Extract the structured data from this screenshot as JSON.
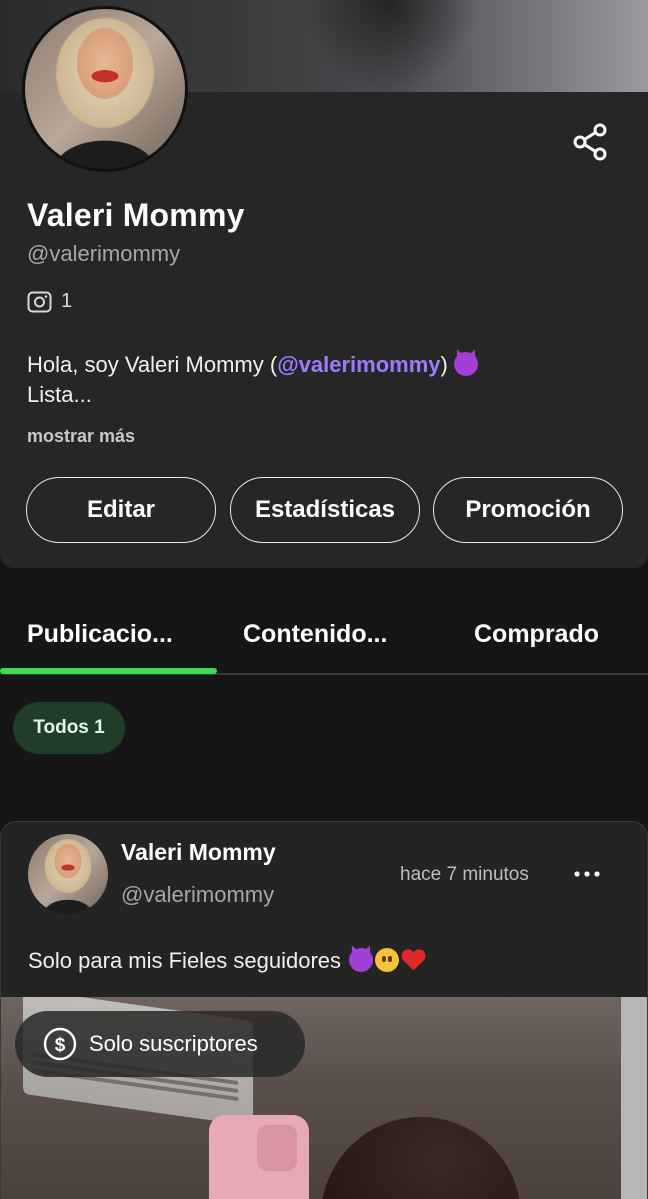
{
  "profile": {
    "display_name": "Valeri Mommy",
    "username": "@valerimommy",
    "post_count": "1",
    "bio_prefix": "Hola, soy Valeri Mommy (",
    "bio_mention": "@valerimommy",
    "bio_suffix": ")",
    "bio_line2": "Lista...",
    "show_more": "mostrar más"
  },
  "actions": {
    "edit": "Editar",
    "stats": "Estadísticas",
    "promo": "Promoción"
  },
  "tabs": [
    {
      "label": "Publicacio...",
      "active": true
    },
    {
      "label": "Contenido...",
      "active": false
    },
    {
      "label": "Comprado",
      "active": false
    }
  ],
  "filter": {
    "label": "Todos 1"
  },
  "post": {
    "author_name": "Valeri Mommy",
    "author_username": "@valerimommy",
    "time": "hace 7 minutos",
    "text": "Solo para mis Fieles seguidores",
    "badge": "Solo suscriptores"
  },
  "colors": {
    "accent_green": "#3ddc55",
    "mention_purple": "#9d7bff",
    "card_bg": "#262626",
    "page_bg": "#161616"
  },
  "icons": [
    "share-icon",
    "instagram-icon",
    "more-icon",
    "dollar-icon"
  ]
}
